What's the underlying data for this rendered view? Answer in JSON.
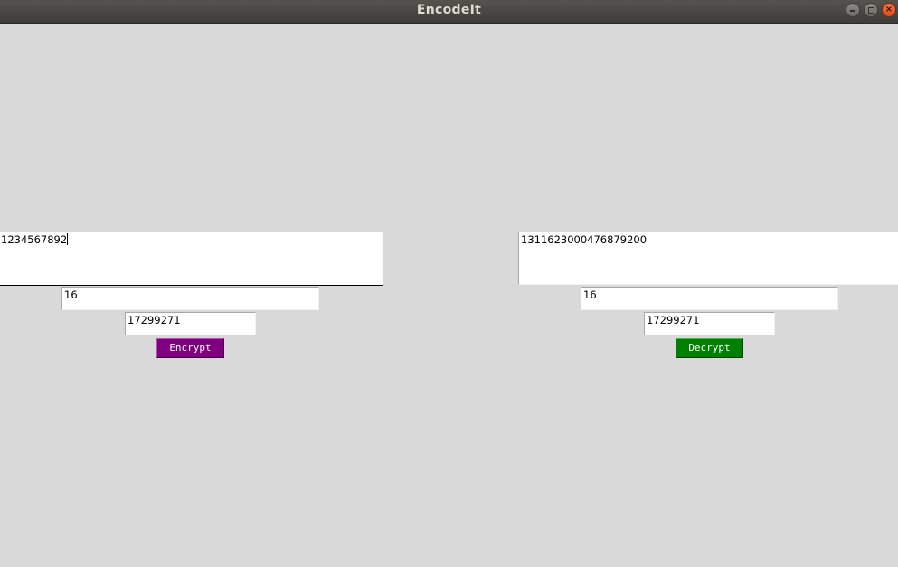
{
  "window": {
    "title": "EncodeIt"
  },
  "encrypt_panel": {
    "message_value": "1234567892",
    "key_one_value": "16",
    "key_two_value": "17299271",
    "button_label": "Encrypt",
    "button_color": "#800080"
  },
  "decrypt_panel": {
    "message_value": "1311623000476879200",
    "key_one_value": "16",
    "key_two_value": "17299271",
    "button_label": "Decrypt",
    "button_color": "#008000"
  },
  "icons": {
    "minimize": "minimize-icon",
    "maximize": "maximize-icon",
    "close": "close-icon"
  }
}
